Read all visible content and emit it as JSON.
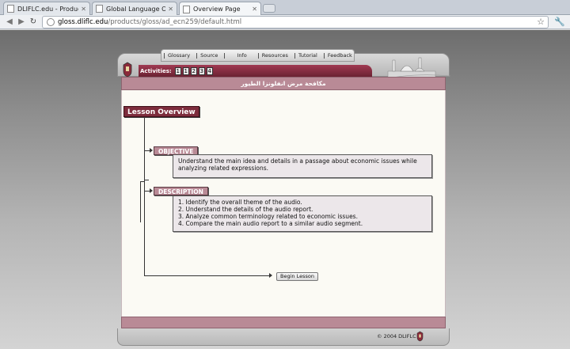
{
  "browser": {
    "tabs": [
      {
        "label": "DLIFLC.edu - Products",
        "active": false
      },
      {
        "label": "Global Language Online",
        "active": false
      },
      {
        "label": "Overview Page",
        "active": true
      }
    ],
    "url_host": "gloss.dliflc.edu",
    "url_path": "/products/gloss/ad_ecn259/default.html"
  },
  "nav": {
    "items": [
      "Glossary",
      "Source",
      "Info",
      "Resources",
      "Tutorial",
      "Feedback"
    ]
  },
  "activities": {
    "label": "Activities:",
    "buttons": [
      "1",
      "1",
      "2",
      "3",
      "4"
    ]
  },
  "lesson": {
    "arabic_title": "مكافحة مرض انفلونزا الطيور",
    "overview_label": "Lesson Overview",
    "objective": {
      "label": "OBJECTIVE",
      "text_line1": "Understand the main idea and details in a passage about economic issues while",
      "text_line2": "analyzing related expressions."
    },
    "description": {
      "label": "DESCRIPTION",
      "items": [
        "1.  Identify the overall theme of the audio.",
        "2.  Understand the details of the audio report.",
        "3.  Analyze common terminology related to economic issues.",
        "4.  Compare the main audio report to a similar audio segment."
      ]
    },
    "begin_label": "Begin Lesson"
  },
  "footer": {
    "copyright": "© 2004 DLIFLC"
  }
}
